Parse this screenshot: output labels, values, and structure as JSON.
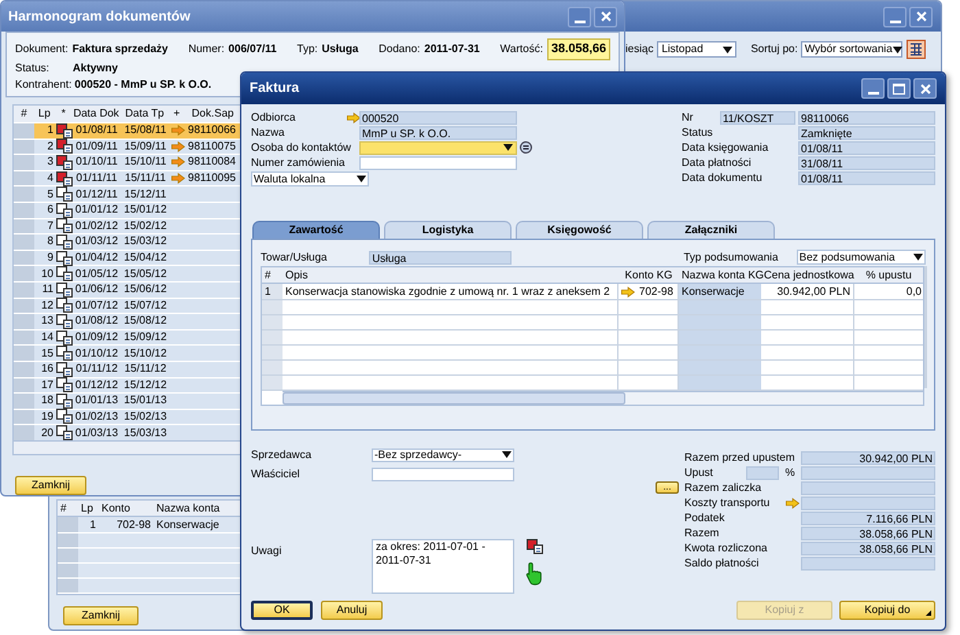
{
  "back_window": {
    "month_label": "iesiąc",
    "month": "Listopad",
    "sort_label": "Sortuj po:",
    "sort": "Wybór sortowania",
    "accounts_table": {
      "columns": [
        "#",
        "Lp",
        "Konto",
        "Nazwa konta"
      ],
      "rows": [
        {
          "lp": "1",
          "account": "702-98",
          "name": "Konserwacje"
        }
      ]
    },
    "close_button": "Zamknij"
  },
  "schedule_window": {
    "title": "Harmonogram dokumentów",
    "header_fields": [
      {
        "label": "Dokument:",
        "value": "Faktura sprzedaży",
        "highlighted": false
      },
      {
        "label": "Numer:",
        "value": "006/07/11",
        "highlighted": false
      },
      {
        "label": "Typ:",
        "value": "Usługa",
        "highlighted": false
      },
      {
        "label": "Dodano:",
        "value": "2011-07-31",
        "highlighted": false
      },
      {
        "label": "Wartość:",
        "value": "38.058,66",
        "highlighted": true
      }
    ],
    "status": {
      "label": "Status:",
      "value": "Aktywny"
    },
    "contractor": {
      "label": "Kontrahent:",
      "value": "000520 - MmP u SP. k O.O."
    },
    "table": {
      "columns": [
        "#",
        "Lp",
        "*",
        "Data Dok",
        "Data Tp",
        "+",
        "Dok.Sap"
      ],
      "rows": [
        {
          "lp": "1",
          "flagged": true,
          "doc_date": "01/08/11",
          "due_date": "15/08/11",
          "sap_doc": "98110066",
          "selected": true
        },
        {
          "lp": "2",
          "flagged": true,
          "doc_date": "01/09/11",
          "due_date": "15/09/11",
          "sap_doc": "98110075",
          "selected": false
        },
        {
          "lp": "3",
          "flagged": true,
          "doc_date": "01/10/11",
          "due_date": "15/10/11",
          "sap_doc": "98110084",
          "selected": false
        },
        {
          "lp": "4",
          "flagged": true,
          "doc_date": "01/11/11",
          "due_date": "15/11/11",
          "sap_doc": "98110095",
          "selected": false
        },
        {
          "lp": "5",
          "flagged": false,
          "doc_date": "01/12/11",
          "due_date": "15/12/11",
          "selected": false
        },
        {
          "lp": "6",
          "flagged": false,
          "doc_date": "01/01/12",
          "due_date": "15/01/12",
          "selected": false
        },
        {
          "lp": "7",
          "flagged": false,
          "doc_date": "01/02/12",
          "due_date": "15/02/12",
          "selected": false
        },
        {
          "lp": "8",
          "flagged": false,
          "doc_date": "01/03/12",
          "due_date": "15/03/12",
          "selected": false
        },
        {
          "lp": "9",
          "flagged": false,
          "doc_date": "01/04/12",
          "due_date": "15/04/12",
          "selected": false
        },
        {
          "lp": "10",
          "flagged": false,
          "doc_date": "01/05/12",
          "due_date": "15/05/12",
          "selected": false
        },
        {
          "lp": "11",
          "flagged": false,
          "doc_date": "01/06/12",
          "due_date": "15/06/12",
          "selected": false
        },
        {
          "lp": "12",
          "flagged": false,
          "doc_date": "01/07/12",
          "due_date": "15/07/12",
          "selected": false
        },
        {
          "lp": "13",
          "flagged": false,
          "doc_date": "01/08/12",
          "due_date": "15/08/12",
          "selected": false
        },
        {
          "lp": "14",
          "flagged": false,
          "doc_date": "01/09/12",
          "due_date": "15/09/12",
          "selected": false
        },
        {
          "lp": "15",
          "flagged": false,
          "doc_date": "01/10/12",
          "due_date": "15/10/12",
          "selected": false
        },
        {
          "lp": "16",
          "flagged": false,
          "doc_date": "01/11/12",
          "due_date": "15/11/12",
          "selected": false
        },
        {
          "lp": "17",
          "flagged": false,
          "doc_date": "01/12/12",
          "due_date": "15/12/12",
          "selected": false
        },
        {
          "lp": "18",
          "flagged": false,
          "doc_date": "01/01/13",
          "due_date": "15/01/13",
          "selected": false
        },
        {
          "lp": "19",
          "flagged": false,
          "doc_date": "01/02/13",
          "due_date": "15/02/13",
          "selected": false
        },
        {
          "lp": "20",
          "flagged": false,
          "doc_date": "01/03/13",
          "due_date": "15/03/13",
          "selected": false
        }
      ]
    },
    "close_button": "Zamknij"
  },
  "invoice_window": {
    "title": "Faktura",
    "header_left": [
      {
        "label": "Odbiorca",
        "value": "000520",
        "kind": "link"
      },
      {
        "label": "Nazwa",
        "value": "MmP u SP. k O.O.",
        "kind": "readonly"
      },
      {
        "label": "Osoba do kontaktów",
        "kind": "combo"
      },
      {
        "label": "Numer zamówienia",
        "kind": "input"
      }
    ],
    "currency": "Waluta lokalna",
    "header_right": [
      {
        "label": "Nr",
        "prefix": "11/KOSZT",
        "value": "98110066"
      },
      {
        "label": "Status",
        "value": "Zamknięte"
      },
      {
        "label": "Data księgowania",
        "value": "01/08/11"
      },
      {
        "label": "Data płatności",
        "value": "31/08/11"
      },
      {
        "label": "Data dokumentu",
        "value": "01/08/11"
      }
    ],
    "tabs": [
      {
        "label": "Zawartość",
        "selected": true
      },
      {
        "label": "Logistyka",
        "selected": false
      },
      {
        "label": "Księgowość",
        "selected": false
      },
      {
        "label": "Załączniki",
        "selected": false
      }
    ],
    "item_type": {
      "label": "Towar/Usługa",
      "value": "Usługa"
    },
    "summary_type": {
      "label": "Typ podsumowania",
      "value": "Bez podsumowania"
    },
    "lines": {
      "columns": [
        "#",
        "Opis",
        "Konto KG",
        "Nazwa konta KG",
        "Cena jednostkowa",
        "% upustu"
      ],
      "rows": [
        {
          "number": "1",
          "description": "Konserwacja stanowiska zgodnie z umową nr. 1 wraz z aneksem 2",
          "account": "702-98",
          "account_name": "Konserwacje",
          "unit_price": "30.942,00 PLN",
          "discount": "0,0"
        }
      ]
    },
    "salesperson": {
      "label": "Sprzedawca",
      "value": "-Bez sprzedawcy-"
    },
    "owner": {
      "label": "Właściciel"
    },
    "remarks": {
      "label": "Uwagi",
      "value": "za okres: 2011-07-01 - 2011-07-31"
    },
    "totals": [
      {
        "label": "Razem przed upustem",
        "value": "30.942,00 PLN",
        "kind": "plain"
      },
      {
        "label": "Upust",
        "kind": "percent",
        "unit": "%"
      },
      {
        "label": "Razem zaliczka",
        "kind": "more",
        "button": "..."
      },
      {
        "label": "Koszty transportu",
        "kind": "link"
      },
      {
        "label": "Podatek",
        "value": "7.116,66 PLN",
        "kind": "plain"
      },
      {
        "label": "Razem",
        "value": "38.058,66 PLN",
        "kind": "plain"
      },
      {
        "label": "Kwota rozliczona",
        "value": "38.058,66 PLN",
        "kind": "plain"
      },
      {
        "label": "Saldo płatności",
        "kind": "plain"
      }
    ],
    "buttons_left": [
      {
        "label": "OK",
        "disabled": false,
        "kind": "default"
      },
      {
        "label": "Anuluj",
        "disabled": false,
        "kind": "plain"
      }
    ],
    "buttons_right": [
      {
        "label": "Kopiuj z",
        "disabled": true,
        "kind": "plain"
      },
      {
        "label": "Kopiuj do",
        "disabled": false,
        "kind": "menu"
      }
    ]
  }
}
